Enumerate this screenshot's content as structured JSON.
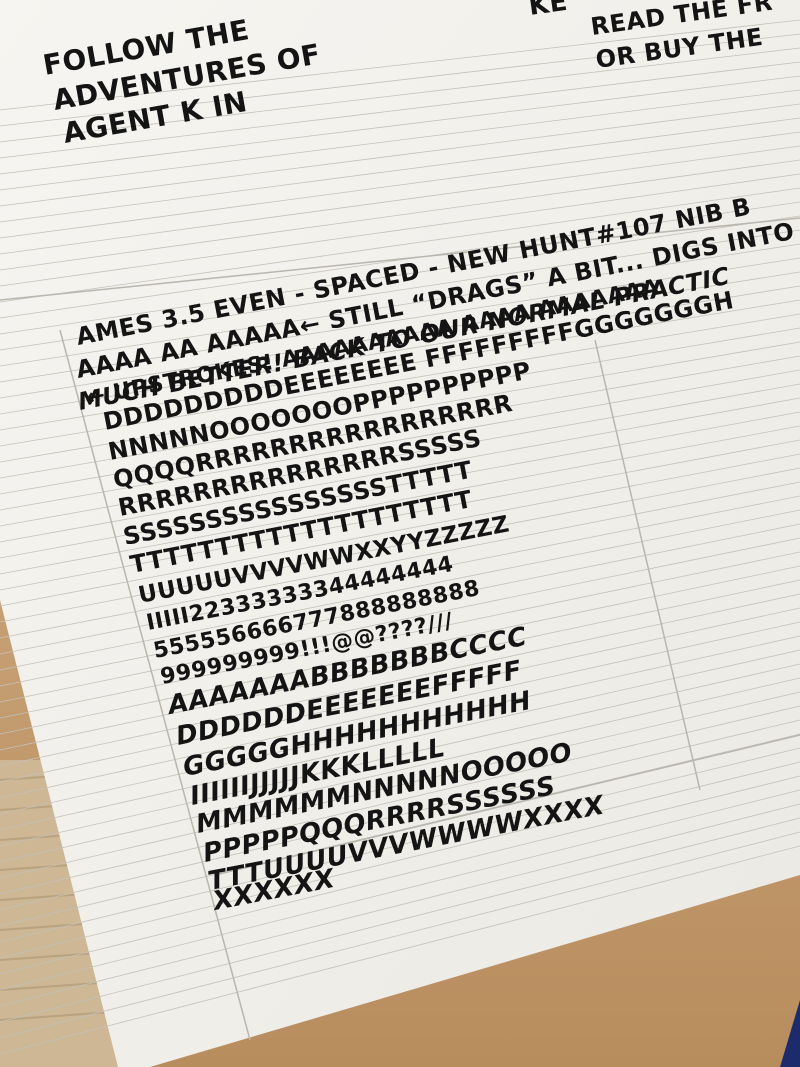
{
  "header": {
    "left_lines": [
      "FOLLOW THE",
      "ADVENTURES OF",
      "AGENT K IN"
    ],
    "center_fragment": "KE",
    "right_lines": [
      "READ THE FR",
      "OR BUY THE"
    ]
  },
  "practice_lines": [
    "AMES 3.5 EVEN - SPACED - NEW HUNT#107 NIB  B",
    "AAAA AA AAAAA← STILL “DRAGS” A BIT... DIGS INTO",
    "MUCH BETTER! BACK TO OUR NORMAL PRACTIC",
    "← UPSTROKES!  AAAAAAAAAA AAAA AAAAAAA",
    "DDDDDDDDDEEEEEEEE FFFFFFFFFGGGGGGGH",
    "NNNNNOOOOOOOPPPPPPPPPP",
    "QQQQRRRRRRRRRRRRRRRRR",
    "RRRRRRRRRRRRRRRSSSSS",
    "SSSSSSSSSSSSSSSSTTTTT",
    "TTTTTTTTTTTTTTTTTTTT",
    "UUUUUVVVVWWXXYYZZZZZ",
    "IIIII22333333344444444",
    "555556666777888888888",
    "999999999!!!@@????///",
    "AAAAAAABBBBBBBCCCC",
    "DDDDDDEEEEEEEFFFFF",
    "GGGGGHHHHHHHHHHH",
    "IIIIIIJJJJJKKKLLLLL",
    "MMMMMMNNNNNOOOOO",
    "PPPPPQQQRRRRSSSSSS",
    "TTTUUUUVVVWWWWXXXX",
    "XXXXXX"
  ],
  "colors": {
    "paper": "#f4f3ef",
    "table": "#c9a57a",
    "ink": "#141414",
    "pencil_rule": "#b9b6ae"
  }
}
